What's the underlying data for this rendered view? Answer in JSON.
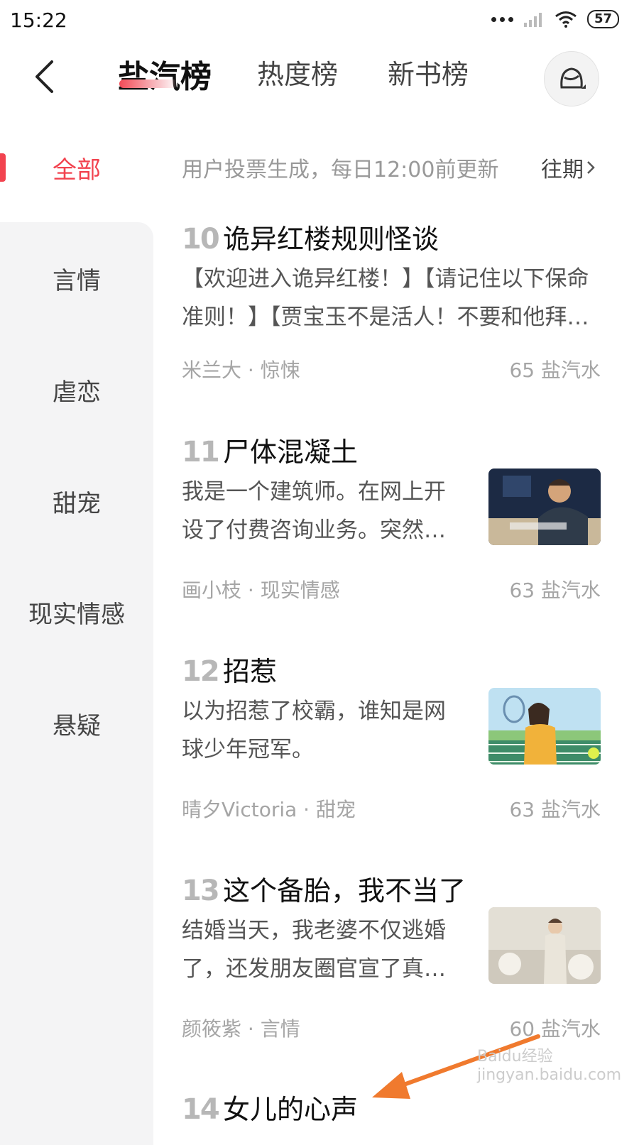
{
  "status_bar": {
    "time": "15:22",
    "battery": "57"
  },
  "header": {
    "tabs": [
      {
        "label": "盐汽榜",
        "active": true
      },
      {
        "label": "热度榜",
        "active": false
      },
      {
        "label": "新书榜",
        "active": false
      }
    ],
    "icons": {
      "back": "chevron-left-icon",
      "avatar": "avatar-icon"
    }
  },
  "sidebar": {
    "items": [
      {
        "label": "全部",
        "active": true
      },
      {
        "label": "言情"
      },
      {
        "label": "虐恋"
      },
      {
        "label": "甜宠"
      },
      {
        "label": "现实情感"
      },
      {
        "label": "悬疑"
      }
    ]
  },
  "notice": {
    "text": "用户投票生成，每日12:00前更新",
    "past_label": "往期"
  },
  "books": [
    {
      "rank": "10",
      "title": "诡异红楼规则怪谈",
      "desc": "【欢迎进入诡异红楼！】【请记住以下保命准则！】【贾宝玉不是活人！不要和他拜…",
      "meta": "米兰大 · 惊悚",
      "votes": "65 盐汽水"
    },
    {
      "rank": "11",
      "title": "尸体混凝土",
      "desc": "我是一个建筑师。在网上开设了付费咨询业务。突然有…",
      "meta": "画小枝 · 现实情感",
      "votes": "63 盐汽水"
    },
    {
      "rank": "12",
      "title": "招惹",
      "desc": "以为招惹了校霸，谁知是网球少年冠军。",
      "meta": "晴夕Victoria · 甜宠",
      "votes": "63 盐汽水"
    },
    {
      "rank": "13",
      "title": "这个备胎，我不当了",
      "desc": "结婚当天，我老婆不仅逃婚了，还发朋友圈官宣了真…",
      "meta": "颜筱紫 · 言情",
      "votes": "60 盐汽水"
    },
    {
      "rank": "14",
      "title": "女儿的心声"
    }
  ],
  "watermark": {
    "text": "Baidu经验 jingyan.baidu.com"
  },
  "colors": {
    "accent": "#f2434f",
    "annotation_arrow": "#f07a2e"
  }
}
